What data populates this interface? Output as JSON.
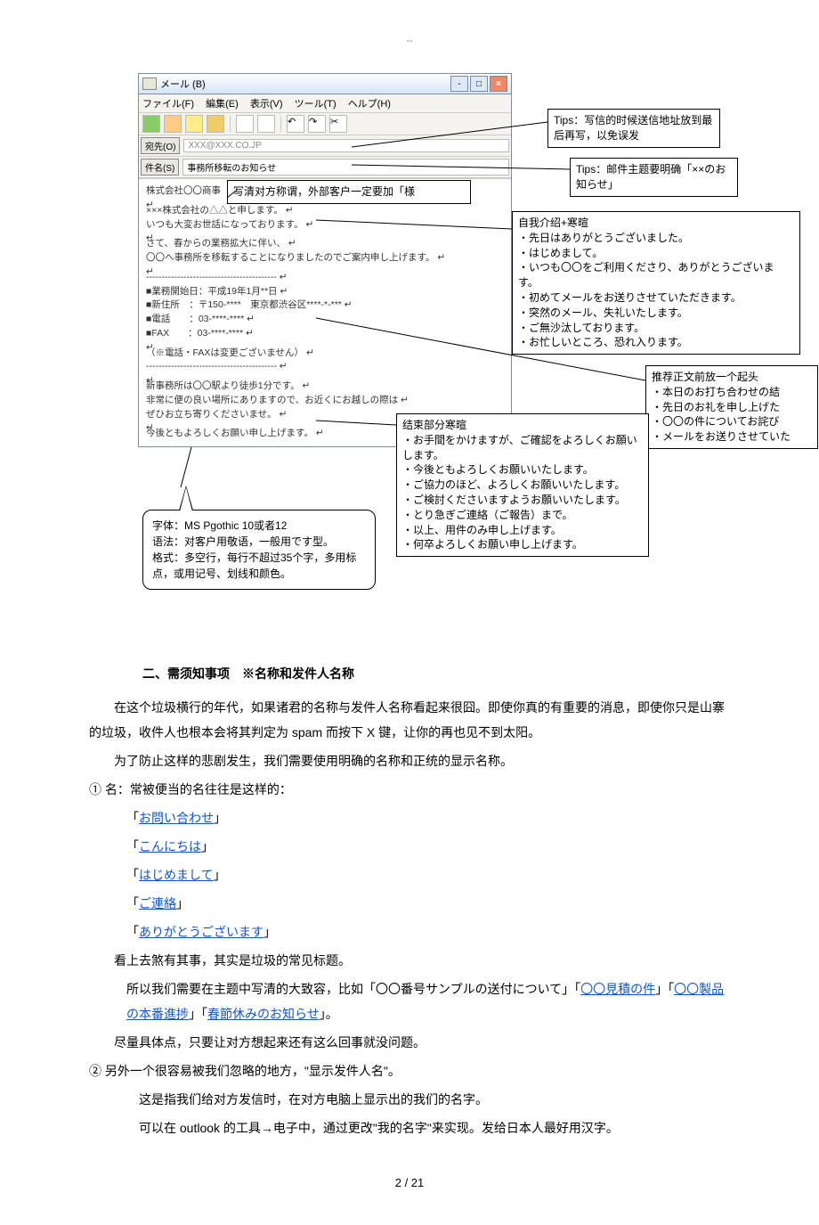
{
  "top_marker": "--",
  "mail_window": {
    "title": "メール (B)",
    "menu": {
      "file": "ファイル(F)",
      "edit": "編集(E)",
      "view": "表示(V)",
      "tool": "ツール(T)",
      "help": "ヘルプ(H)"
    },
    "to_label": "宛先(O)",
    "to_value": "XXX@XXX.CO.JP",
    "subject_label": "件名(S)",
    "subject_value": "事務所移転のお知らせ",
    "body_lines": [
      "株式会社〇〇商事　××様",
      "",
      "×××株式会社の△△と申します。",
      "いつも大変お世話になっております。",
      "",
      "さて、春からの業務拡大に伴い、",
      "〇〇へ事務所を移転することになりましたのでご案内申し上げます。",
      "",
      "------------------------------------------",
      "■業務開始日：平成19年1月**日",
      "■新住所　：〒150-****　東京都渋谷区****-*-***",
      "■電話　　：03-****-****",
      "■FAX　　：03-****-****",
      "",
      "（※電話・FAXは変更ございません）",
      "------------------------------------------",
      "",
      "新事務所は〇〇駅より徒歩1分です。",
      "非常に便の良い場所にありますので、お近くにお越しの際は",
      "ぜひお立ち寄りくださいませ。",
      "",
      "今後ともよろしくお願い申し上げます。"
    ]
  },
  "callouts": {
    "tip_to": "Tips：写信的时候送信地址放到最后再写，以免误发",
    "tip_subject": "Tips：邮件主题要明确「××のお知らせ」",
    "honorific": "写清对方称谓，外部客户一定要加「様",
    "intro": {
      "title": "自我介绍+寒暄",
      "lines": [
        "・先日はありがとうございました。",
        "・はじめまして。",
        "・いつも〇〇をご利用くださり、ありがとうございます。",
        "・初めてメールをお送りさせていただきます。",
        "・突然のメール、失礼いたします。",
        "・ご無沙汰しております。",
        "・お忙しいところ、恐れ入ります。"
      ]
    },
    "lead": {
      "title": "推荐正文前放一个起头",
      "lines": [
        "・本日のお打ち合わせの結",
        "・先日のお礼を申し上げた",
        "・〇〇の件についてお詫び",
        "・メールをお送りさせていた"
      ]
    },
    "closing": {
      "title": "结束部分寒暄",
      "lines": [
        "・お手間をかけますが、ご確認をよろしくお願いします。",
        "・今後ともよろしくお願いいたします。",
        "・ご協力のほど、よろしくお願いいたします。",
        "・ご検討くださいますようお願いいたします。",
        "・とり急ぎご連絡（ご報告）まで。",
        "・以上、用件のみ申し上げます。",
        "・何卒よろしくお願い申し上げます。"
      ]
    },
    "speech": {
      "l1": "字体：MS Pgothic 10或者12",
      "l2": "语法：对客户用敬语，一般用です型。",
      "l3": "格式：多空行，每行不超过35个字，多用标点，或用记号、划线和颜色。"
    }
  },
  "article": {
    "h3": "二、需须知事项　※名称和发件人名称",
    "p1": "在这个垃圾横行的年代，如果诸君的名称与发件人名称看起来很囧。即使你真的有重要的消息，即使你只是山寨的垃圾，收件人也根本会将其判定为 spam 而按下 X 键，让你的再也见不到太阳。",
    "p2": "为了防止这样的悲剧发生，我们需要使用明确的名称和正统的显示名称。",
    "num1": "① 名：常被便当的名往往是这样的：",
    "items1": [
      "「お問い合わせ」",
      "「こんにちは」",
      "「はじめまして」",
      "「ご連絡」",
      "「ありがとうございます」"
    ],
    "p3": "看上去煞有其事，其实是垃圾的常见标题。",
    "p4_a": "所以我们需要在主题中写清的大致容，比如「〇〇番号サンプルの送付について」「",
    "p4_link1": "〇〇見積の件",
    "p4_b": "」「",
    "p4_link2": "〇〇製品の本番進捗",
    "p4_c": "」「",
    "p4_link3": "春節休みのお知らせ",
    "p4_d": "」。",
    "p5": "尽量具体点，只要让对方想起来还有这么回事就没问题。",
    "num2": "② 另外一个很容易被我们忽略的地方，\"显示发件人名\"。",
    "p6": "这是指我们给对方发信时，在对方电脑上显示出的我们的名字。",
    "p7": "可以在 outlook 的工具→电子中，通过更改\"我的名字\"来实现。发给日本人最好用汉字。"
  },
  "page_number": "2 / 21"
}
